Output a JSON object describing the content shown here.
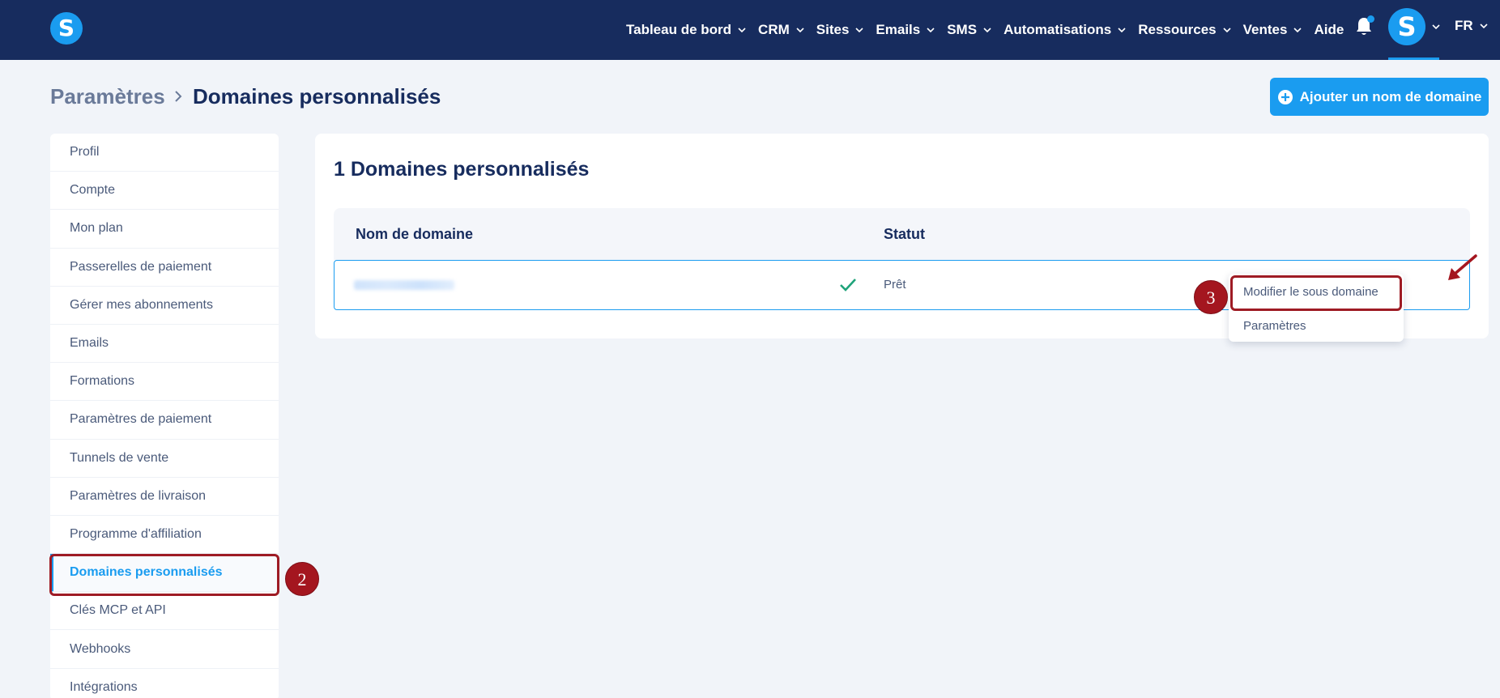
{
  "brand": {
    "logo_letter": "S",
    "accent": "#1a9cf0",
    "nav_bg": "#172c5e",
    "annotation_red": "#a4161f"
  },
  "nav": {
    "items": [
      {
        "label": "Tableau de bord",
        "icon": "chevron-down-icon"
      },
      {
        "label": "CRM",
        "icon": "chevron-down-icon"
      },
      {
        "label": "Sites",
        "icon": "chevron-down-icon"
      },
      {
        "label": "Emails",
        "icon": "chevron-down-icon"
      },
      {
        "label": "SMS",
        "icon": "chevron-down-icon"
      },
      {
        "label": "Automatisations",
        "icon": "chevron-down-icon"
      },
      {
        "label": "Ressources",
        "icon": "chevron-down-icon"
      },
      {
        "label": "Ventes",
        "icon": "chevron-down-icon"
      }
    ],
    "help_label": "Aide",
    "bell_icon": "bell-icon",
    "avatar_letter": "S",
    "language": "FR"
  },
  "breadcrumb": {
    "parent": "Paramètres",
    "current": "Domaines personnalisés"
  },
  "add_button_label": "Ajouter un nom de domaine",
  "sidebar": {
    "items": [
      {
        "label": "Profil"
      },
      {
        "label": "Compte"
      },
      {
        "label": "Mon plan"
      },
      {
        "label": "Passerelles de paiement"
      },
      {
        "label": "Gérer mes abonnements"
      },
      {
        "label": "Emails"
      },
      {
        "label": "Formations"
      },
      {
        "label": "Paramètres de paiement"
      },
      {
        "label": "Tunnels de vente"
      },
      {
        "label": "Paramètres de livraison"
      },
      {
        "label": "Programme d'affiliation"
      },
      {
        "label": "Domaines personnalisés",
        "active": true
      },
      {
        "label": "Clés MCP et API"
      },
      {
        "label": "Webhooks"
      },
      {
        "label": "Intégrations"
      }
    ]
  },
  "main": {
    "title": "1 Domaines personnalisés",
    "table": {
      "columns": [
        "Nom de domaine",
        "Statut"
      ],
      "rows": [
        {
          "domain": "",
          "status_icon": "check-icon",
          "status": "Prêt"
        }
      ]
    },
    "row_actions": [
      "Modifier le sous domaine",
      "Paramètres"
    ]
  },
  "annotations": {
    "step_sidebar": "2",
    "step_menu": "3"
  }
}
